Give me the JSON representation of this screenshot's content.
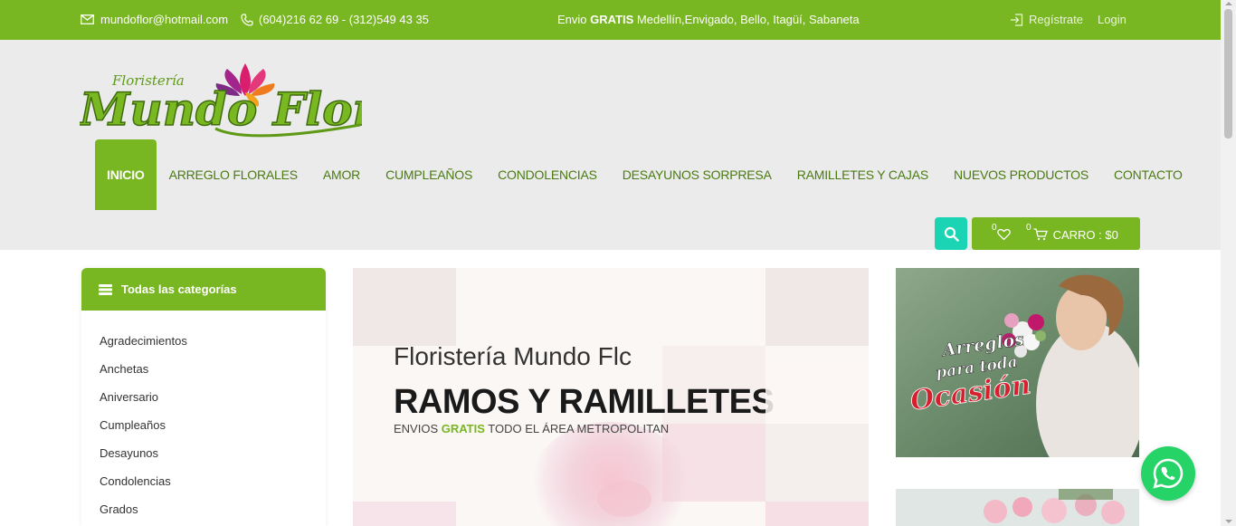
{
  "topbar": {
    "email": "mundoflor@hotmail.com",
    "phone": "(604)216 62 69 - (312)549 43 35",
    "promo_prefix": "Envio ",
    "promo_bold": "GRATIS",
    "promo_suffix": " Medellín,Envigado, Bello, Itagüí, Sabaneta",
    "register": "Regístrate",
    "login": "Login"
  },
  "logo": {
    "small": "Floristería",
    "main": "Mundo Flor"
  },
  "nav": {
    "items": [
      {
        "label": "INICIO"
      },
      {
        "label": "ARREGLO FLORALES"
      },
      {
        "label": "AMOR"
      },
      {
        "label": "CUMPLEAÑOS"
      },
      {
        "label": "CONDOLENCIAS"
      },
      {
        "label": "DESAYUNOS SORPRESA"
      },
      {
        "label": "RAMILLETES Y CAJAS"
      },
      {
        "label": "NUEVOS PRODUCTOS"
      },
      {
        "label": "CONTACTO"
      }
    ]
  },
  "cart": {
    "wishlist_count": "0",
    "cart_count": "0",
    "label": "CARRO : $0"
  },
  "categories": {
    "title": "Todas las categorías",
    "items": [
      "Agradecimientos",
      "Anchetas",
      "Aniversario",
      "Cumpleaños",
      "Desayunos",
      "Condolencias",
      "Grados"
    ]
  },
  "slider": {
    "title": "Floristería Mundo Flc",
    "headline": "RAMOS Y RAMILLETES",
    "sub_prefix": "ENVIOS ",
    "sub_green": "GRATIS",
    "sub_suffix": " TODO EL ÁREA METROPOLITAN"
  },
  "banner1": {
    "line1": "Arreglos",
    "line2": "para toda",
    "line3": "Ocasión"
  },
  "colors": {
    "brand_green": "#78b622",
    "nav_text": "#4a7a12",
    "search_teal": "#1ad4b4",
    "whatsapp": "#25d366"
  }
}
